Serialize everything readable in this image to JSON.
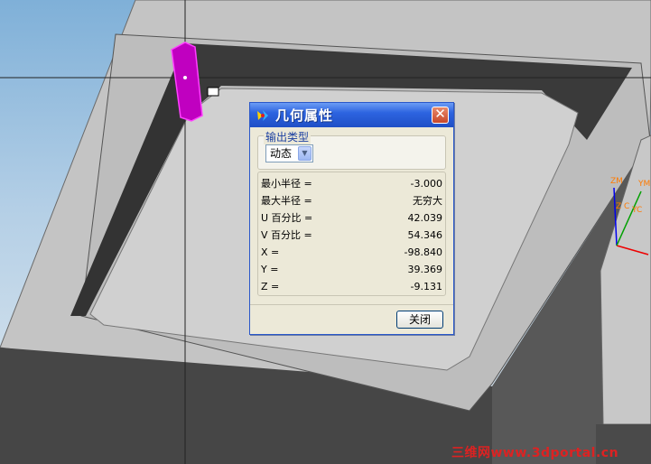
{
  "dialog": {
    "title": "几何属性",
    "output_group_label": "输出类型",
    "output_type_value": "动态",
    "properties": [
      {
        "label": "最小半径 =",
        "value": "-3.000"
      },
      {
        "label": "最大半径 =",
        "value": "无穷大"
      },
      {
        "label": "U 百分比 =",
        "value": "42.039"
      },
      {
        "label": "V 百分比 =",
        "value": "54.346"
      },
      {
        "label": "X =",
        "value": "-98.840"
      },
      {
        "label": "Y =",
        "value": "39.369"
      },
      {
        "label": "Z =",
        "value": "-9.131"
      }
    ],
    "close_label": "关闭",
    "close_symbol": "✕"
  },
  "axes": {
    "zm": "ZM",
    "ym": "YM",
    "zc": "Z C",
    "yc": "YC"
  },
  "watermark": "三维网www.3dportal.cn",
  "colors": {
    "accent": "#2d64e0",
    "highlight_face": "#c000c0",
    "axis": "#ff7a00"
  }
}
